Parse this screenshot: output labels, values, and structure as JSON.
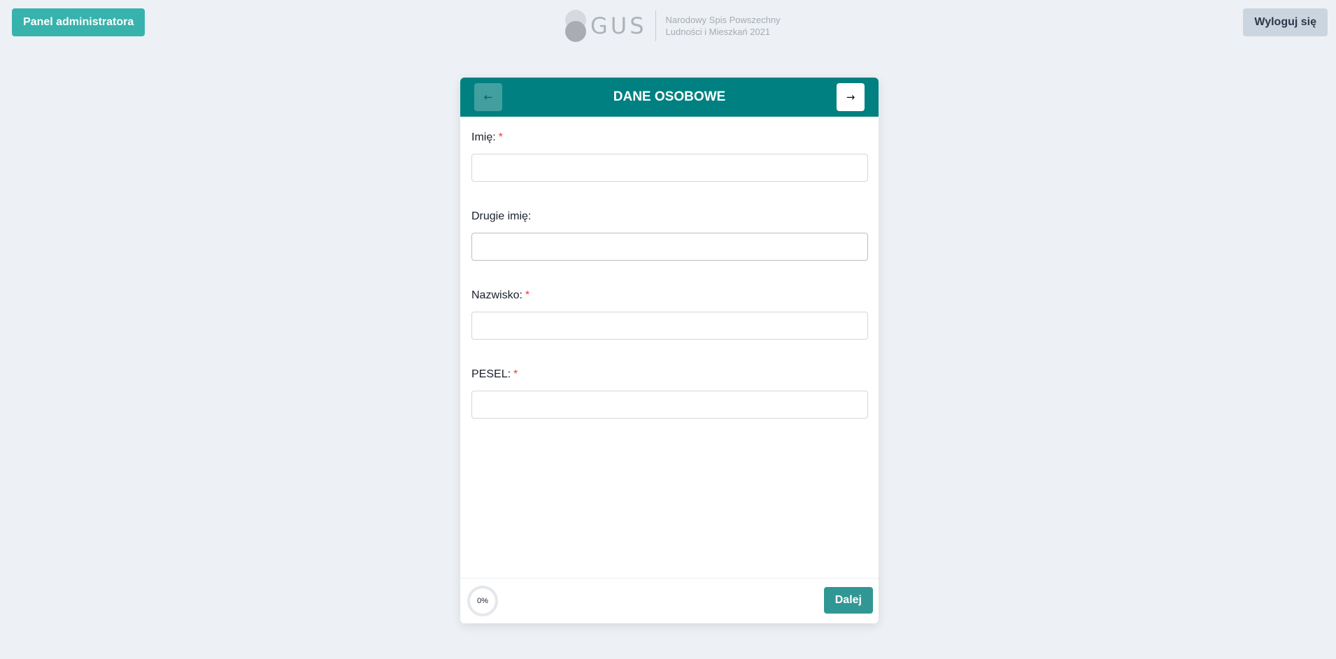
{
  "header": {
    "admin_button": "Panel administratora",
    "logout_button": "Wyloguj się",
    "logo": {
      "word": "GUS",
      "line1": "Narodowy Spis Powszechny",
      "line2": "Ludności i Mieszkań 2021"
    }
  },
  "card": {
    "title": "DANE OSOBOWE",
    "prev_icon": "arrow-left-icon",
    "next_icon": "arrow-right-icon",
    "fields": [
      {
        "label": "Imię:",
        "required": true,
        "value": ""
      },
      {
        "label": "Drugie imię:",
        "required": false,
        "value": ""
      },
      {
        "label": "Nazwisko:",
        "required": true,
        "value": ""
      },
      {
        "label": "PESEL:",
        "required": true,
        "value": ""
      }
    ],
    "required_mark": "*",
    "progress": "0%",
    "next_button": "Dalej"
  },
  "colors": {
    "accent": "#008080",
    "admin_button": "#38b2ac",
    "next_button": "#319795",
    "required": "#e53e3e",
    "background": "#edf1f5"
  }
}
